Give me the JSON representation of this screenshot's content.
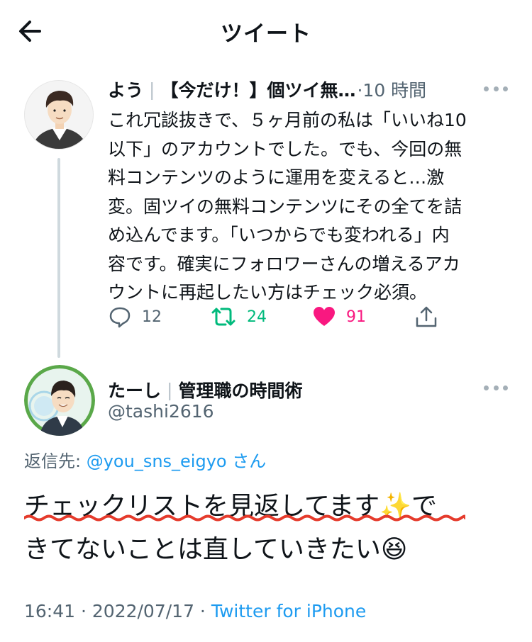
{
  "header": {
    "title": "ツイート"
  },
  "parent_tweet": {
    "display_name": "よう",
    "profile_suffix": "【今だけ！】個ツイ無…",
    "time": "10 時間",
    "body_lines": [
      "これ冗談抜きで、５ヶ月前の私は「いいね10",
      "以下」のアカウントでした。でも、今回の無",
      "料コンテンツのように運用を変えると…激",
      "変。固ツイの無料コンテンツにその全てを詰",
      "め込んでます。「いつからでも変われる」内",
      "容です。確実にフォロワーさんの増えるアカ",
      "ウントに再起したい方はチェック必須。"
    ],
    "replies": "12",
    "retweets": "24",
    "likes": "91",
    "colors": {
      "retweet": "#00ba7c",
      "like": "#f91880"
    }
  },
  "reply_tweet": {
    "display_name": "たーし",
    "profile_suffix": "管理職の時間術",
    "handle": "@tashi2616",
    "reply_label": "返信先: ",
    "reply_mention": "@you_sns_eigyo",
    "reply_suffix": " さん",
    "text_line1": "チェックリストを見返してます",
    "sparkles_emoji": "✨",
    "text_line1_tail": "で",
    "text_line2": "きてないことは直していきたい",
    "grin_emoji": "😆",
    "timestamp": "16:41 · 2022/07/17 · ",
    "source": "Twitter for iPhone"
  },
  "accent_color": "#1d9bf0"
}
